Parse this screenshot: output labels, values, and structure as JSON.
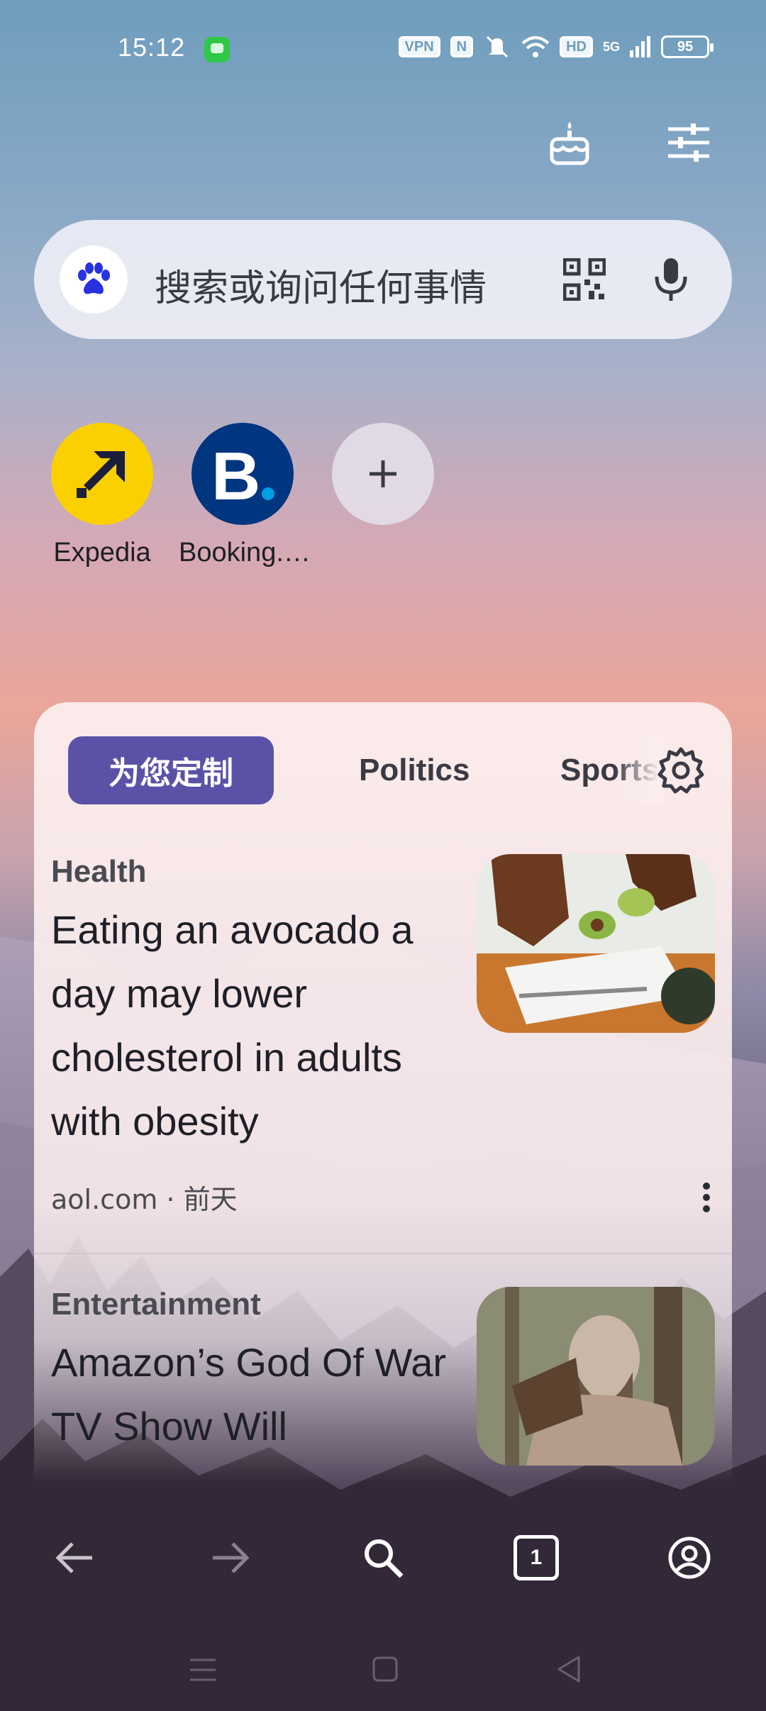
{
  "status_bar": {
    "time": "15:12",
    "vpn": "VPN",
    "nfc": "N",
    "hd": "HD",
    "network": "5G",
    "battery": "95"
  },
  "top_actions": {
    "icons": [
      "birthday-cake-icon",
      "sliders-icon"
    ]
  },
  "search": {
    "placeholder": "搜索或询问任何事情",
    "icons": [
      "baidu-paw-icon",
      "qr-code-icon",
      "microphone-icon"
    ]
  },
  "shortcuts": [
    {
      "label": "Expedia",
      "color": "#fbd000"
    },
    {
      "label": "Booking.…",
      "color": "#003580"
    }
  ],
  "feed": {
    "tabs": [
      {
        "label": "为您定制",
        "active": true
      },
      {
        "label": "Politics",
        "active": false
      },
      {
        "label": "Sports",
        "active": false
      }
    ],
    "articles": [
      {
        "category": "Health",
        "title": "Eating an avocado a day may lower cholesterol in adults with obesity",
        "source": "aol.com · 前天"
      },
      {
        "category": "Entertainment",
        "title": "Amazon’s God Of War TV Show Will"
      }
    ]
  },
  "bottom_nav": {
    "tab_count": "1",
    "icons": [
      "back-arrow-icon",
      "forward-arrow-icon",
      "search-icon",
      "tabs-icon",
      "account-icon"
    ]
  },
  "colors": {
    "accent": "#5b52a8",
    "search_bg": "#eeeef6"
  }
}
